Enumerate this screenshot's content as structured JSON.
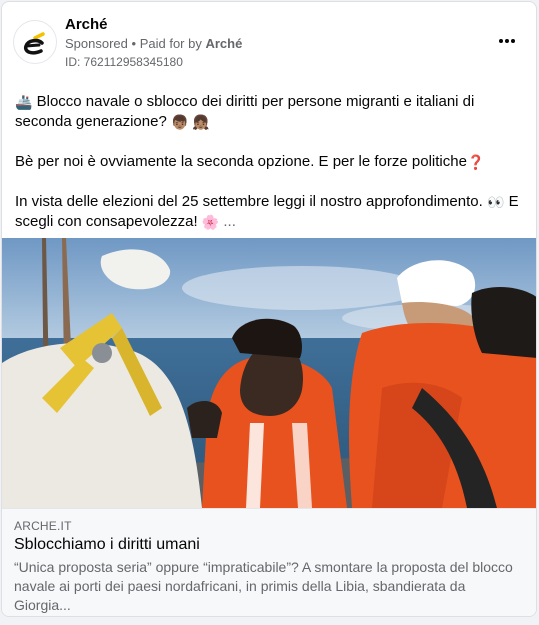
{
  "post": {
    "page_name": "Arché",
    "sponsored_label": "Sponsored",
    "separator": "•",
    "paid_for_by_label": "Paid for by",
    "paid_for_by": "Arché",
    "ad_id": "ID: 762112958345180",
    "more_icon": "more-horizontal-icon",
    "text": {
      "line1": "Blocco navale o sblocco dei diritti per persone migranti e italiani di seconda generazione?",
      "line1_emoji_lead": "🚢",
      "line1_emoji_tail": "👦🏽 👧🏽",
      "line2": "Bè per noi è ovviamente la seconda opzione. E per le forze politiche",
      "line2_emoji": "❓",
      "line3": "In vista delle elezioni del 25 settembre leggi il nostro approfondimento.",
      "line3_emoji1": "👀",
      "line3_mid": "E scegli con consapevolezza!",
      "line3_emoji2": "🌸",
      "see_more": "..."
    }
  },
  "link": {
    "domain": "ARCHE.IT",
    "title": "Sblocchiamo i diritti umani",
    "description": "“Unica proposta seria” oppure “impraticabile”? A smontare la proposta del blocco navale ai porti dei paesi nordafricani, in primis della Libia, sbandierata da Giorgia..."
  },
  "colors": {
    "text_primary": "#050505",
    "text_secondary": "#65676b",
    "link_box_bg": "#f7f8fa",
    "life_jacket": "#e8521e",
    "logo_yellow": "#f2c300"
  }
}
